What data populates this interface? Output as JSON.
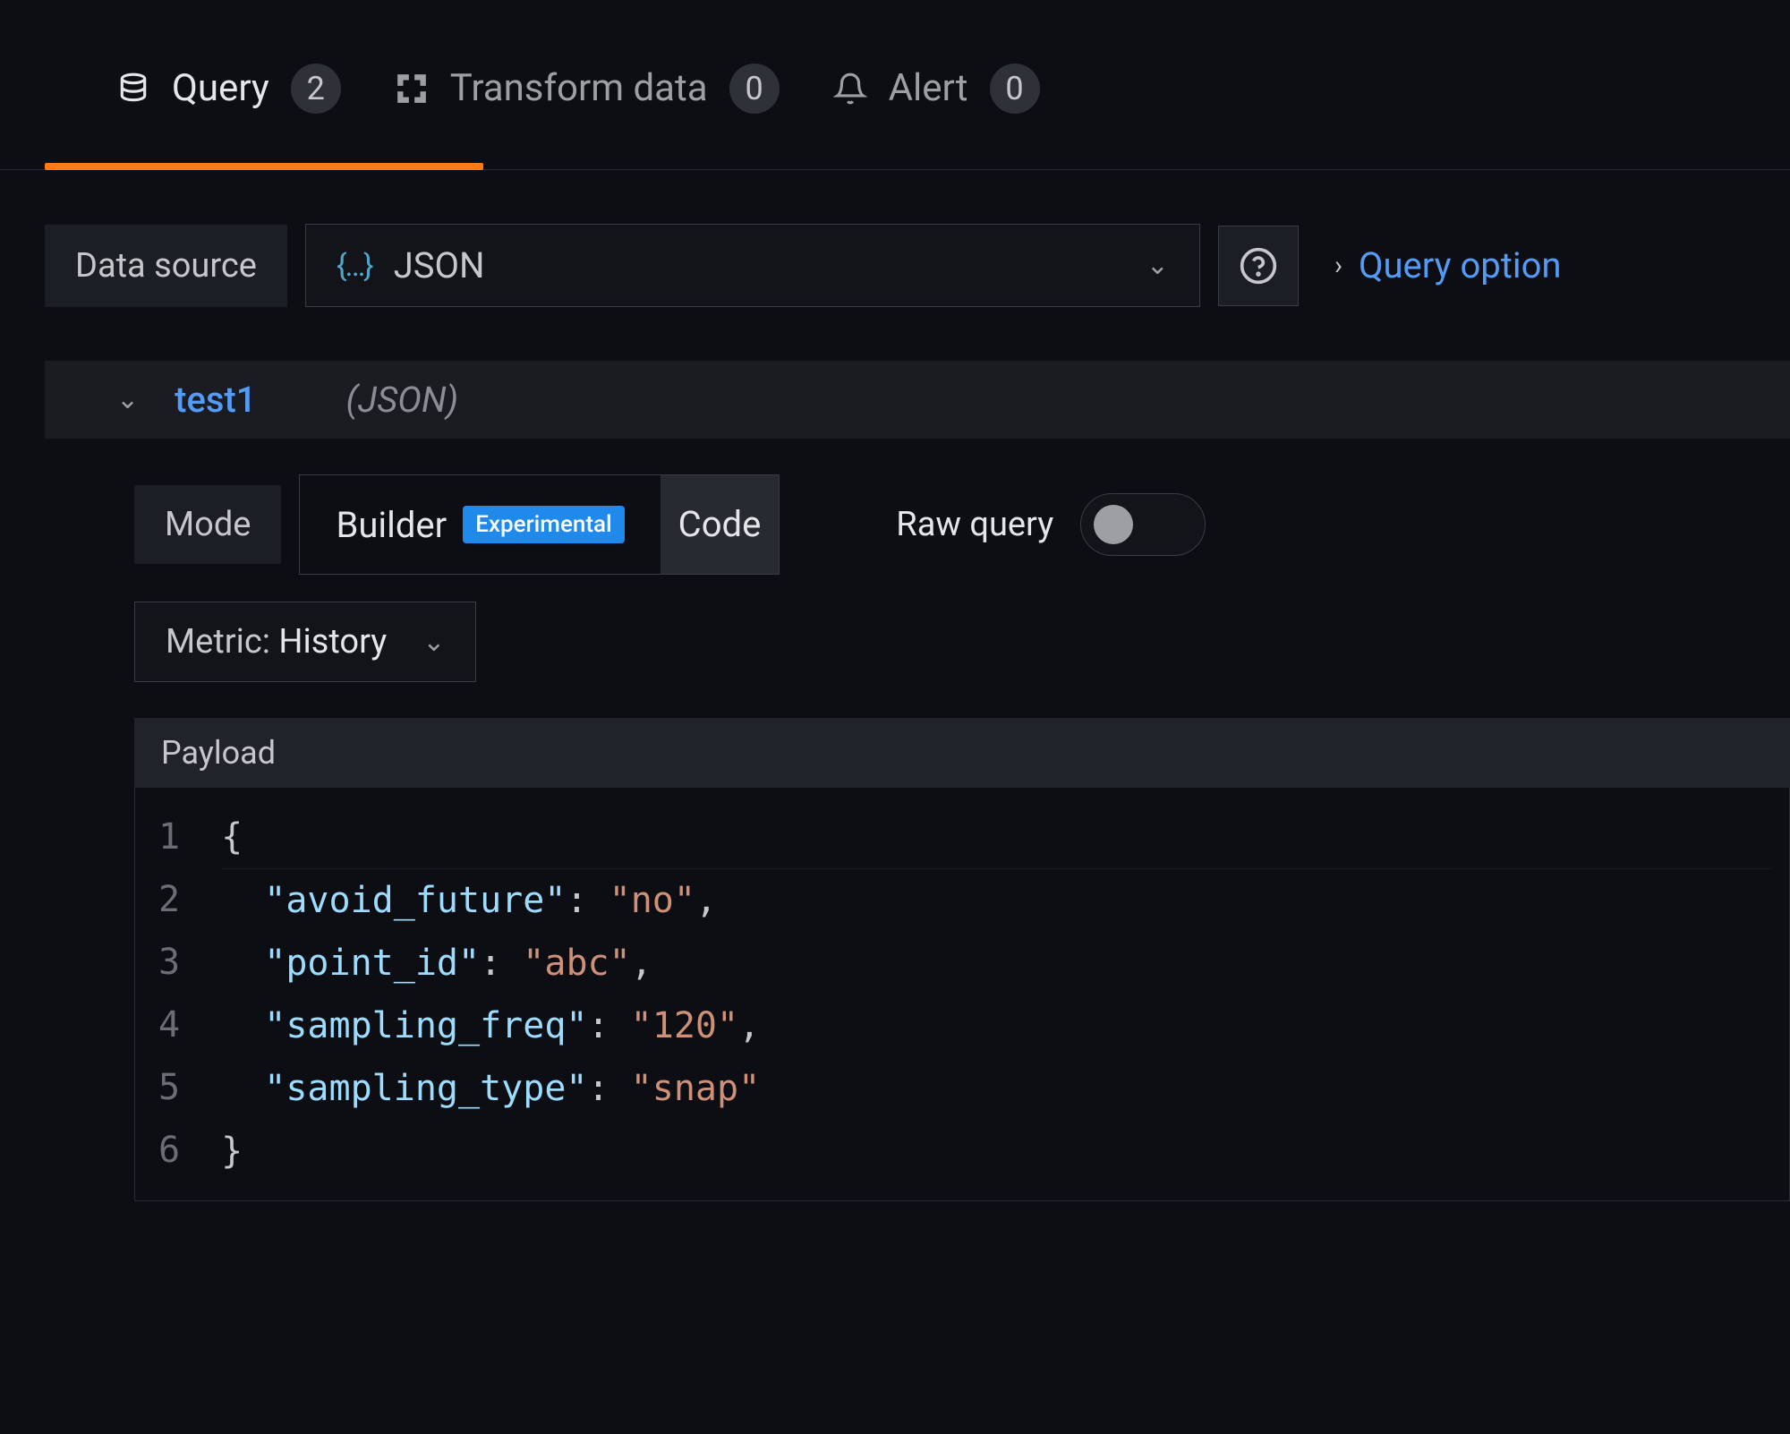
{
  "tabs": [
    {
      "label": "Query",
      "count": "2"
    },
    {
      "label": "Transform data",
      "count": "0"
    },
    {
      "label": "Alert",
      "count": "0"
    }
  ],
  "toolbar": {
    "dataSourceLabel": "Data source",
    "dataSourceValue": "JSON",
    "queryOptionsLabel": "Query option"
  },
  "query": {
    "name": "test1",
    "dsHint": "(JSON)",
    "modeLabel": "Mode",
    "builderLabel": "Builder",
    "builderChip": "Experimental",
    "codeLabel": "Code",
    "rawQueryLabel": "Raw query",
    "metricLabel": "Metric:",
    "metricValue": "History",
    "payloadTitle": "Payload",
    "payload": {
      "avoid_future": "no",
      "point_id": "abc",
      "sampling_freq": "120",
      "sampling_type": "snap"
    },
    "lines": [
      "1",
      "2",
      "3",
      "4",
      "5",
      "6"
    ]
  }
}
